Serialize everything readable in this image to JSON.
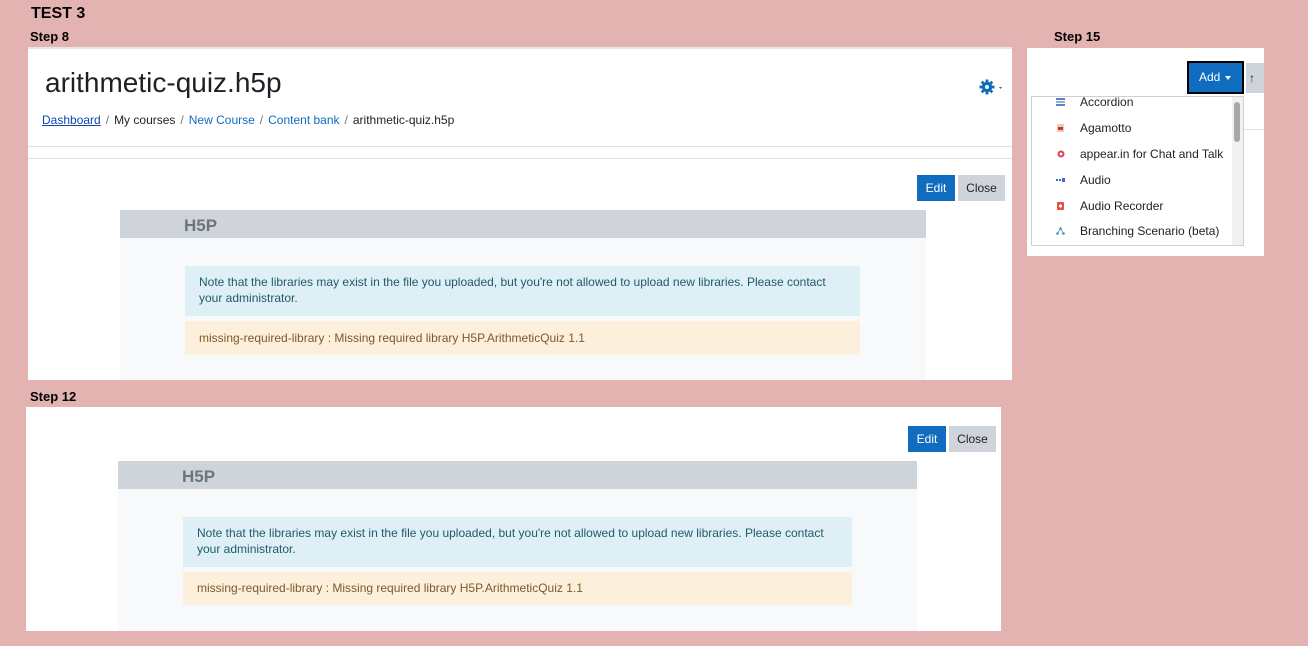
{
  "test_title": "TEST 3",
  "step8": {
    "label": "Step 8",
    "page_title": "arithmetic-quiz.h5p",
    "breadcrumb": [
      "Dashboard",
      "My courses",
      "New Course",
      "Content bank",
      "arithmetic-quiz.h5p"
    ],
    "breadcrumb_sep": "/",
    "edit_label": "Edit",
    "close_label": "Close",
    "h5p_logo": "H5P",
    "info_message": "Note that the libraries may exist in the file you uploaded, but you're not allowed to upload new libraries. Please contact your administrator.",
    "warn_message": "missing-required-library : Missing required library H5P.ArithmeticQuiz 1.1"
  },
  "step12": {
    "label": "Step 12",
    "edit_label": "Edit",
    "close_label": "Close",
    "h5p_logo": "H5P",
    "info_message": "Note that the libraries may exist in the file you uploaded, but you're not allowed to upload new libraries. Please contact your administrator.",
    "warn_message": "missing-required-library : Missing required library H5P.ArithmeticQuiz 1.1"
  },
  "step15": {
    "label": "Step 15",
    "add_label": "Add",
    "menu_items": [
      {
        "label": "Accordion",
        "icon": "accordion-icon",
        "color": "#5b82c4"
      },
      {
        "label": "Agamotto",
        "icon": "agamotto-icon",
        "color": "#c0392b"
      },
      {
        "label": "appear.in for Chat and Talk",
        "icon": "appear-in-icon",
        "color": "#e0455a"
      },
      {
        "label": "Audio",
        "icon": "audio-icon",
        "color": "#3b6fb6"
      },
      {
        "label": "Audio Recorder",
        "icon": "audio-recorder-icon",
        "color": "#e74c3c"
      },
      {
        "label": "Branching Scenario (beta)",
        "icon": "branching-scenario-icon",
        "color": "#4a90b8"
      }
    ]
  },
  "colors": {
    "background": "#e3b3b2",
    "primary": "#0f6cbf",
    "secondary": "#ced4da",
    "info_bg": "#def0f5",
    "warn_bg": "#fcefdc"
  }
}
